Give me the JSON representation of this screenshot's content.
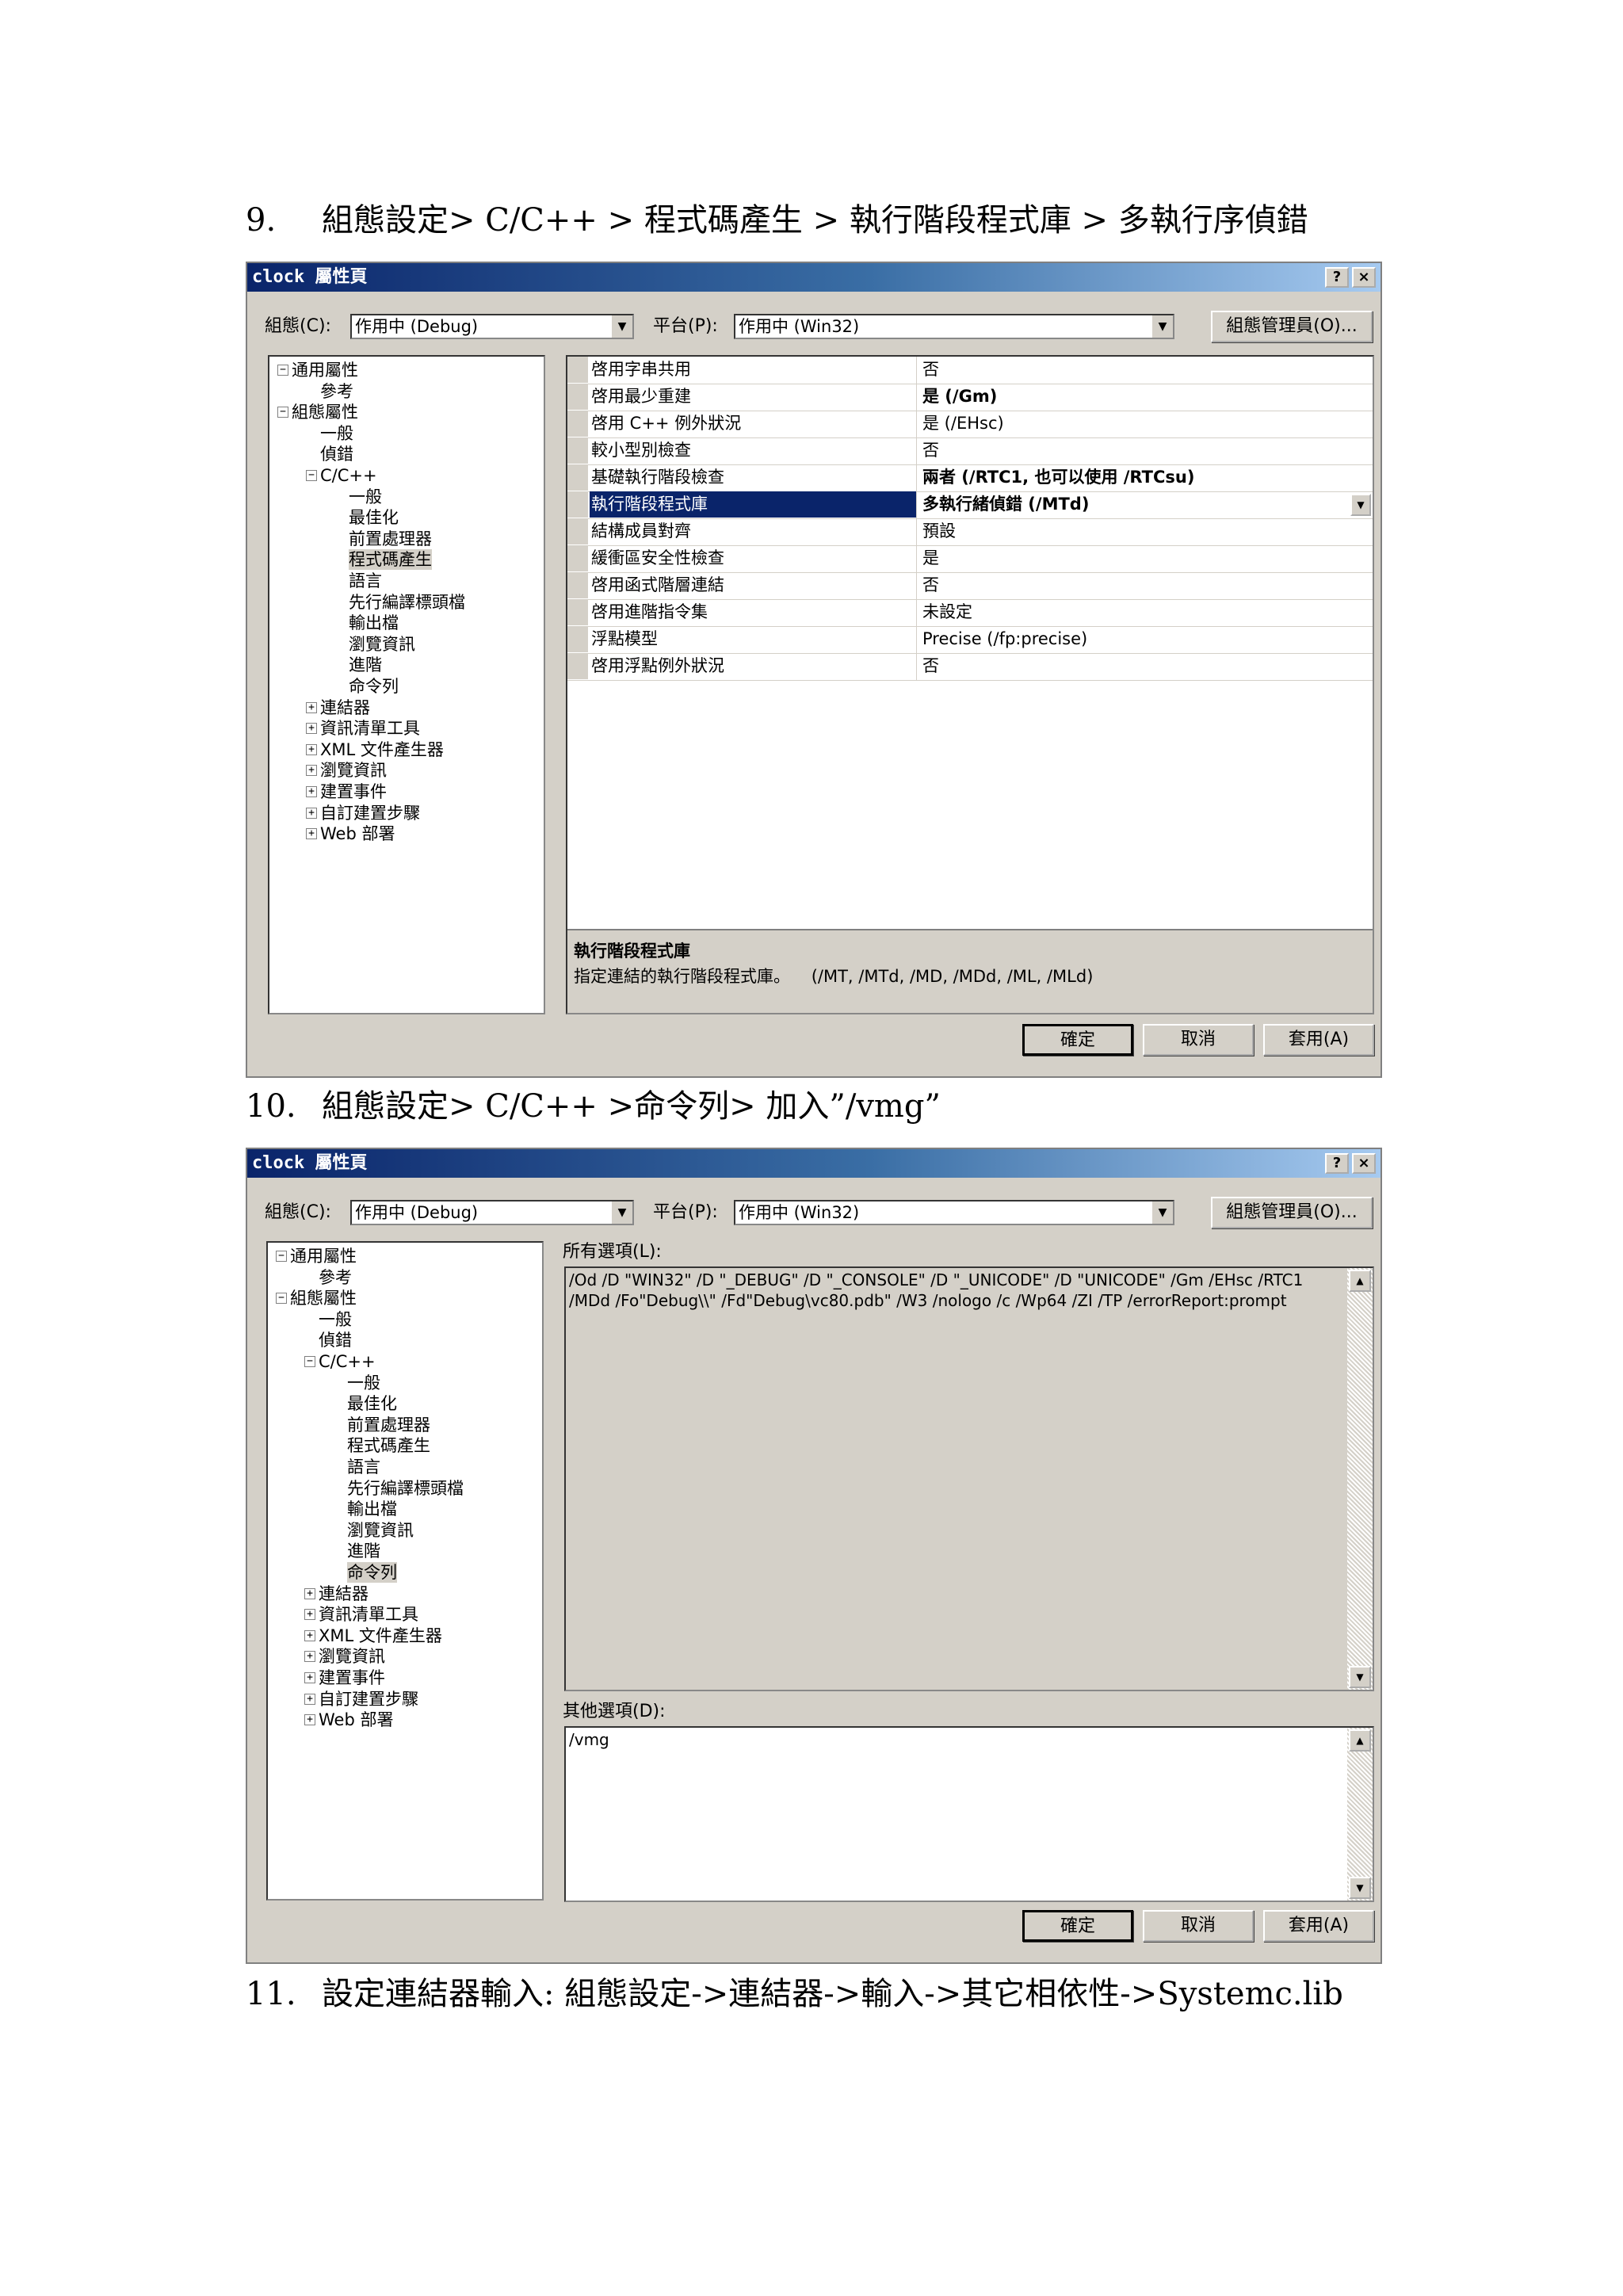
{
  "step9": {
    "number": "9.",
    "text": "組態設定> C/C++ > 程式碼產生 > 執行階段程式庫 > 多執行序偵錯"
  },
  "step10": {
    "number": "10.",
    "text": "組態設定> C/C++ >命令列> 加入”/vmg”"
  },
  "step11": {
    "number": "11.",
    "text": "設定連結器輸入: 組態設定->連結器->輸入->其它相依性->Systemc.lib"
  },
  "dialog": {
    "title": "clock 屬性頁",
    "help_button": "?",
    "close_button": "×",
    "config_label": "組態(C):",
    "config_value": "作用中 (Debug)",
    "platform_label": "平台(P):",
    "platform_value": "作用中 (Win32)",
    "config_manager": "組態管理員(O)...",
    "ok": "確定",
    "cancel": "取消",
    "apply": "套用(A)",
    "tree_a": [
      {
        "label": "通用屬性",
        "exp": "−"
      },
      {
        "label": "參考"
      },
      {
        "label": "組態屬性",
        "exp": "−"
      },
      {
        "label": "一般"
      },
      {
        "label": "偵錯"
      },
      {
        "label": "C/C++",
        "exp": "−"
      },
      {
        "label": "一般"
      },
      {
        "label": "最佳化"
      },
      {
        "label": "前置處理器"
      },
      {
        "label": "程式碼產生"
      },
      {
        "label": "語言"
      },
      {
        "label": "先行編譯標頭檔"
      },
      {
        "label": "輸出檔"
      },
      {
        "label": "瀏覽資訊"
      },
      {
        "label": "進階"
      },
      {
        "label": "命令列"
      },
      {
        "label": "連結器",
        "exp": "+"
      },
      {
        "label": "資訊清單工具",
        "exp": "+"
      },
      {
        "label": "XML 文件產生器",
        "exp": "+"
      },
      {
        "label": "瀏覽資訊",
        "exp": "+"
      },
      {
        "label": "建置事件",
        "exp": "+"
      },
      {
        "label": "自訂建置步驟",
        "exp": "+"
      },
      {
        "label": "Web 部署",
        "exp": "+"
      }
    ]
  },
  "dialog1": {
    "properties": [
      {
        "name": "啓用字串共用",
        "value": "否"
      },
      {
        "name": "啓用最少重建",
        "value": "是 (/Gm)"
      },
      {
        "name": "啓用 C++ 例外狀況",
        "value": "是 (/EHsc)"
      },
      {
        "name": "較小型別檢查",
        "value": "否"
      },
      {
        "name": "基礎執行階段檢查",
        "value": "兩者 (/RTC1, 也可以使用 /RTCsu)"
      },
      {
        "name": "執行階段程式庫",
        "value": "多執行緒偵錯 (/MTd)"
      },
      {
        "name": "結構成員對齊",
        "value": "預設"
      },
      {
        "name": "緩衝區安全性檢查",
        "value": "是"
      },
      {
        "name": "啓用函式階層連結",
        "value": "否"
      },
      {
        "name": "啓用進階指令集",
        "value": "未設定"
      },
      {
        "name": "浮點模型",
        "value": "Precise (/fp:precise)"
      },
      {
        "name": "啓用浮點例外狀況",
        "value": "否"
      }
    ],
    "desc_title": "執行階段程式庫",
    "desc_text": "指定連結的執行階段程式庫。    (/MT, /MTd, /MD, /MDd, /ML, /MLd)"
  },
  "dialog2": {
    "all_options_label": "所有選項(L):",
    "all_options_line1": "/Od /D \"WIN32\" /D \"_DEBUG\" /D \"_CONSOLE\" /D \"_UNICODE\" /D \"UNICODE\" /Gm /EHsc /RTC1",
    "all_options_line2": "/MDd /Fo\"Debug\\\\\" /Fd\"Debug\\vc80.pdb\" /W3 /nologo /c /Wp64 /ZI /TP /errorReport:prompt",
    "other_options_label": "其他選項(D):",
    "other_options_value": "/vmg"
  }
}
